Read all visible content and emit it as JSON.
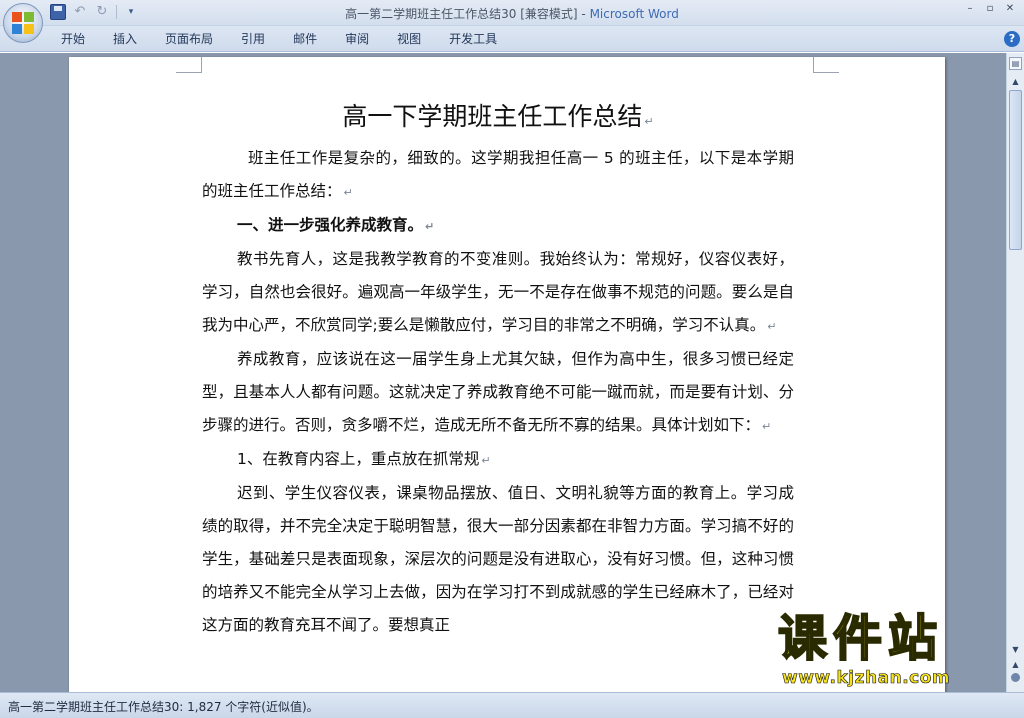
{
  "window": {
    "title": "高一第二学期班主任工作总结30 [兼容模式] - ",
    "app_name": "Microsoft Word"
  },
  "ribbon": {
    "tabs": [
      "开始",
      "插入",
      "页面布局",
      "引用",
      "邮件",
      "审阅",
      "视图",
      "开发工具"
    ]
  },
  "document": {
    "title": "高一下学期班主任工作总结",
    "paragraphs": [
      {
        "text": "班主任工作是复杂的，细致的。这学期我担任高一 5 的班主任，以下是本学期的班主任工作总结：",
        "indent": "first-wide"
      },
      {
        "text": "一、进一步强化养成教育。",
        "bold": true
      },
      {
        "text": "教书先育人，这是我教学教育的不变准则。我始终认为：常规好，仪容仪表好，学习，自然也会很好。遍观高一年级学生，无一不是存在做事不规范的问题。要么是自我为中心严，不欣赏同学;要么是懒散应付，学习目的非常之不明确，学习不认真。"
      },
      {
        "text": "养成教育，应该说在这一届学生身上尤其欠缺，但作为高中生，很多习惯已经定型，且基本人人都有问题。这就决定了养成教育绝不可能一蹴而就，而是要有计划、分步骤的进行。否则，贪多嚼不烂，造成无所不备无所不寡的结果。具体计划如下："
      },
      {
        "text": "1、在教育内容上，重点放在抓常规"
      },
      {
        "text": "迟到、学生仪容仪表，课桌物品摆放、值日、文明礼貌等方面的教育上。学习成绩的取得，并不完全决定于聪明智慧，很大一部分因素都在非智力方面。学习搞不好的学生，基础差只是表面现象，深层次的问题是没有进取心，没有好习惯。但，这种习惯的培养又不能完全从学习上去做，因为在学习打不到成就感的学生已经麻木了，已经对这方面的教育充耳不闻了。要想真正"
      }
    ]
  },
  "statusbar": {
    "text": "高一第二学期班主任工作总结30: 1,827 个字符(近似值)。"
  },
  "watermark": {
    "main": "课件站",
    "url": "www.kjzhan.com"
  },
  "colors": {
    "titlebar": "#d3deee",
    "doc_background": "#8a98ad",
    "app_name": "#3e6bb4",
    "watermark": "#f5e21c"
  }
}
